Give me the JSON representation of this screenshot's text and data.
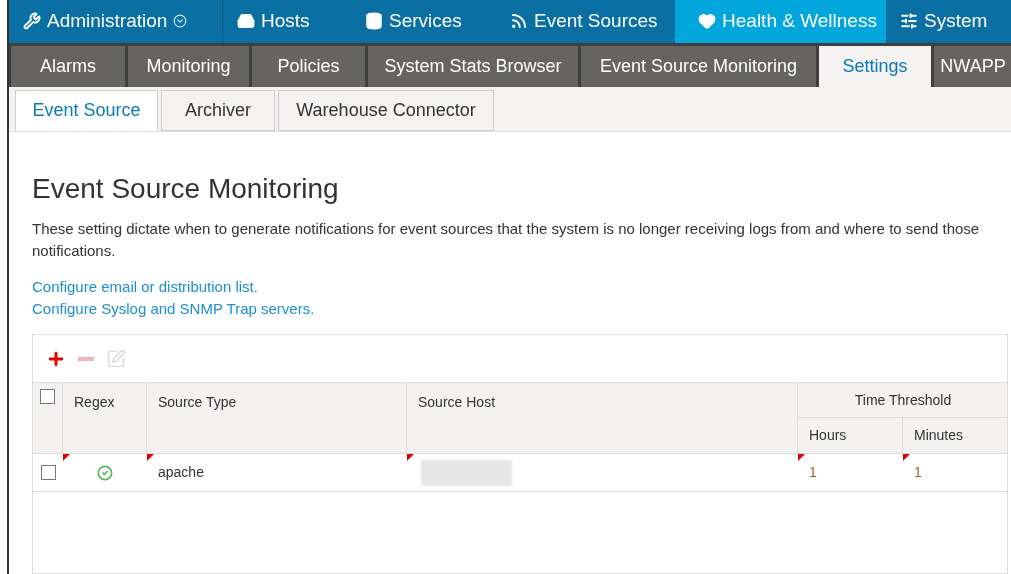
{
  "top_nav": [
    {
      "label": "Administration",
      "dropdown": true,
      "selected": false
    },
    {
      "label": "Hosts",
      "selected": false
    },
    {
      "label": "Services",
      "selected": false
    },
    {
      "label": "Event Sources",
      "selected": false
    },
    {
      "label": "Health & Wellness",
      "selected": true
    },
    {
      "label": "System",
      "selected": false
    }
  ],
  "tabs": [
    {
      "label": "Alarms",
      "selected": false
    },
    {
      "label": "Monitoring",
      "selected": false
    },
    {
      "label": "Policies",
      "selected": false
    },
    {
      "label": "System Stats Browser",
      "selected": false
    },
    {
      "label": "Event Source Monitoring",
      "selected": false
    },
    {
      "label": "Settings",
      "selected": true
    },
    {
      "label": "NWAPP",
      "selected": false
    }
  ],
  "subtabs": [
    {
      "label": "Event Source",
      "selected": true
    },
    {
      "label": "Archiver",
      "selected": false
    },
    {
      "label": "Warehouse Connector",
      "selected": false
    }
  ],
  "heading": "Event Source Monitoring",
  "description": "These setting dictate when to generate notifications for event sources that the system is no longer receiving logs from and where to send those notifications.",
  "links": [
    "Configure email or distribution list.",
    "Configure Syslog and SNMP Trap servers."
  ],
  "toolbar": [
    {
      "kind": "add",
      "disabled": false
    },
    {
      "kind": "remove",
      "disabled": true
    },
    {
      "kind": "edit",
      "disabled": true
    }
  ],
  "table": {
    "select_all": {
      "checked": false
    },
    "columns": [
      "Regex",
      "Source Type",
      "Source Host"
    ],
    "group": "Time Threshold",
    "subcolumns": [
      "Hours",
      "Minutes"
    ],
    "rows": [
      {
        "checked": false,
        "regex": true,
        "source_type": "apache",
        "source_host_redacted": true,
        "hours": "1",
        "minutes": "1",
        "modified": true
      }
    ]
  }
}
